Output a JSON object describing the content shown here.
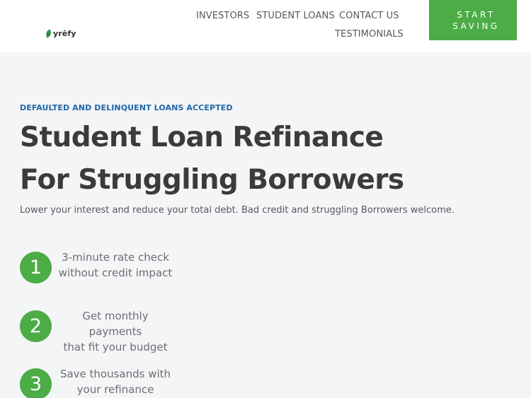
{
  "brand": {
    "name": "yrēfy"
  },
  "nav": {
    "investors": "INVESTORS",
    "student_loans": "STUDENT LOANS",
    "contact_us": "CONTACT US",
    "testimonials": "TESTIMONIALS"
  },
  "cta": {
    "line1": "START",
    "line2": "SAVING"
  },
  "hero": {
    "eyebrow": "DEFAULTED AND DELINQUENT LOANS ACCEPTED",
    "headline_line1": "Student Loan Refinance",
    "headline_line2": "For Struggling Borrowers",
    "subtitle": "Lower your interest and reduce your total debt. Bad credit and struggling Borrowers welcome."
  },
  "steps": [
    {
      "number": "1",
      "line1": "3-minute rate check",
      "line2": "without credit impact"
    },
    {
      "number": "2",
      "line1": "Get monthly payments",
      "line2": "that fit your budget"
    },
    {
      "number": "3",
      "line1": "Save thousands with",
      "line2": "your refinance"
    }
  ],
  "colors": {
    "accent_green": "#4cac46",
    "eyebrow_blue": "#1f67a8",
    "headline": "#3a3b3d",
    "page_background": "#f4f5f7"
  },
  "icons": {
    "logo_mark": "leaf-icon"
  }
}
